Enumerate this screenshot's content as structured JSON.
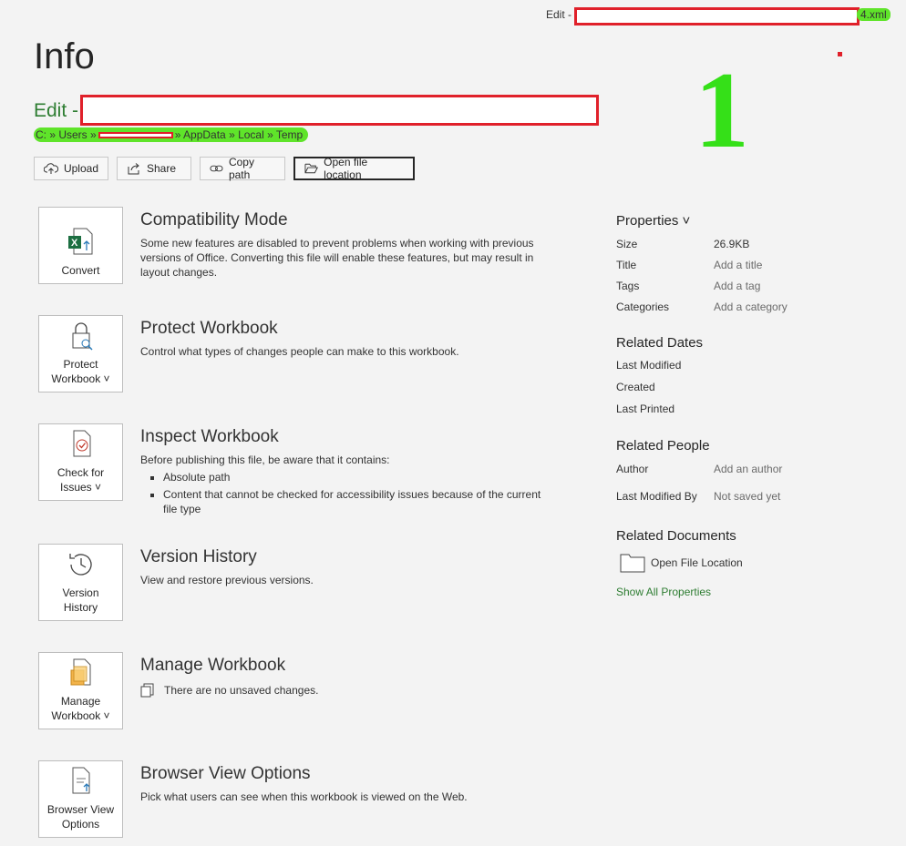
{
  "window": {
    "title_prefix": "Edit -",
    "title_suffix": "4.xml"
  },
  "annotation": {
    "number": "1"
  },
  "page": {
    "title": "Info",
    "file_title_prefix": "Edit -",
    "path_start": "C: » Users »",
    "path_end": "» AppData » Local » Temp"
  },
  "actions": [
    {
      "label": "Upload",
      "icon": "cloud-upload-icon"
    },
    {
      "label": "Share",
      "icon": "share-icon"
    },
    {
      "label": "Copy path",
      "icon": "link-icon"
    },
    {
      "label": "Open file location",
      "icon": "folder-open-icon"
    }
  ],
  "sections": {
    "compat": {
      "tile": "Convert",
      "title": "Compatibility Mode",
      "desc": "Some new features are disabled to prevent problems when working with previous versions of Office. Converting this file will enable these features, but may result in layout changes."
    },
    "protect": {
      "tile1": "Protect",
      "tile2": "Workbook ˅",
      "title": "Protect Workbook",
      "desc": "Control what types of changes people can make to this workbook."
    },
    "inspect": {
      "tile1": "Check for",
      "tile2": "Issues ˅",
      "title": "Inspect Workbook",
      "desc": "Before publishing this file, be aware that it contains:",
      "items": [
        "Absolute path",
        "Content that cannot be checked for accessibility issues because of the current file type"
      ]
    },
    "version": {
      "tile1": "Version",
      "tile2": "History",
      "title": "Version History",
      "desc": "View and restore previous versions."
    },
    "manage": {
      "tile1": "Manage",
      "tile2": "Workbook ˅",
      "title": "Manage Workbook",
      "desc": "There are no unsaved changes."
    },
    "browser": {
      "tile1": "Browser View",
      "tile2": "Options",
      "title": "Browser View Options",
      "desc": "Pick what users can see when this workbook is viewed on the Web."
    }
  },
  "properties": {
    "heading": "Properties ˅",
    "size_label": "Size",
    "size_value": "26.9KB",
    "title_label": "Title",
    "title_value": "Add a title",
    "tags_label": "Tags",
    "tags_value": "Add a tag",
    "categories_label": "Categories",
    "categories_value": "Add a category",
    "dates_heading": "Related Dates",
    "last_modified": "Last Modified",
    "created": "Created",
    "last_printed": "Last Printed",
    "people_heading": "Related People",
    "author_label": "Author",
    "author_value": "Add an author",
    "lastmodby_label": "Last Modified By",
    "lastmodby_value": "Not saved yet",
    "docs_heading": "Related Documents",
    "open_file_location": "Open File Location",
    "show_all": "Show All Properties"
  },
  "colors": {
    "accent_green": "#2e7d32",
    "redaction": "#e0202a",
    "highlight": "#5fe42a"
  }
}
